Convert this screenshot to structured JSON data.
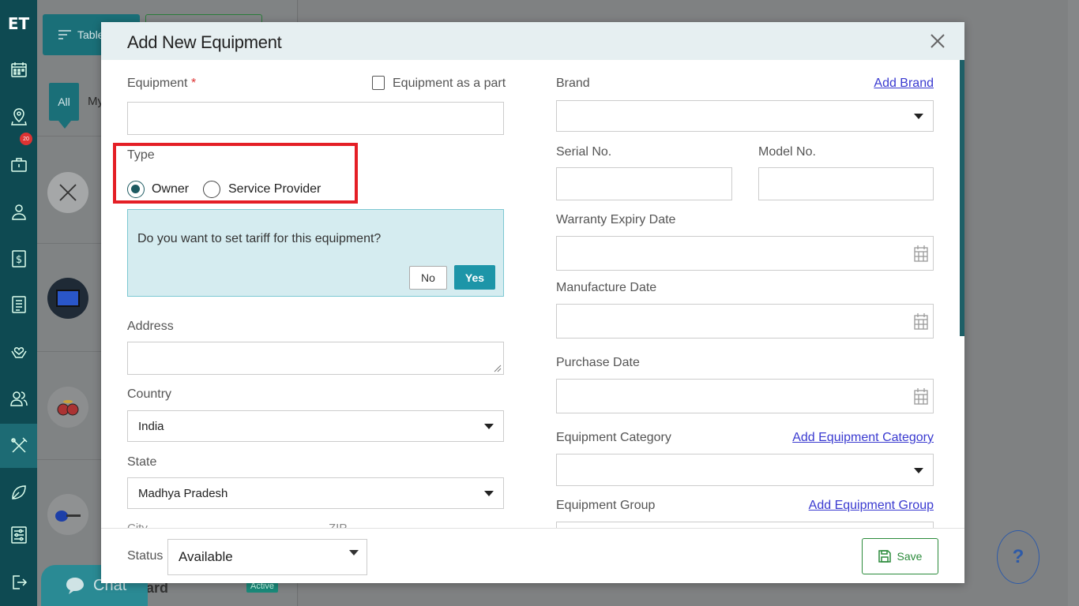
{
  "app": {
    "logo": "ET"
  },
  "nav": {
    "badge_count": "20",
    "items": [
      "calendar-icon",
      "map-pin-icon",
      "briefcase-icon",
      "user-icon",
      "dollar-icon",
      "list-icon",
      "heart-hands-icon",
      "users-icon",
      "tools-icon",
      "leaf-icon",
      "sliders-icon",
      "logout-icon"
    ]
  },
  "background": {
    "table_button": "Table",
    "tab_all": "All",
    "tab_my": "My",
    "footer_text": "ard",
    "status_pill": "Active",
    "chat_label": "Chat"
  },
  "modal": {
    "title": "Add New Equipment",
    "left": {
      "equipment_label": "Equipment",
      "required_mark": "*",
      "equipment_value": "",
      "as_part_label": "Equipment as a part",
      "type_label": "Type",
      "type_options": [
        "Owner",
        "Service Provider"
      ],
      "type_selected": "Owner",
      "tariff_question": "Do you want to set tariff for this equipment?",
      "tariff_no": "No",
      "tariff_yes": "Yes",
      "address_label": "Address",
      "address_value": "",
      "country_label": "Country",
      "country_value": "India",
      "state_label": "State",
      "state_value": "Madhya Pradesh",
      "city_label": "City",
      "zip_label": "ZIP"
    },
    "right": {
      "brand_label": "Brand",
      "add_brand": "Add Brand",
      "serial_label": "Serial No.",
      "model_label": "Model No.",
      "warranty_label": "Warranty Expiry Date",
      "manufacture_label": "Manufacture Date",
      "purchase_label": "Purchase Date",
      "category_label": "Equipment Category",
      "add_category": "Add Equipment Category",
      "group_label": "Equipment Group",
      "add_group": "Add Equipment Group"
    },
    "footer": {
      "status_label": "Status",
      "status_value": "Available",
      "save_label": "Save"
    }
  },
  "help": {
    "label": "?"
  },
  "colors": {
    "rail": "#0e4a52",
    "accent": "#1d95a8",
    "highlight": "#e41f26",
    "link": "#3a3ad0",
    "save": "#2a8a3a"
  }
}
